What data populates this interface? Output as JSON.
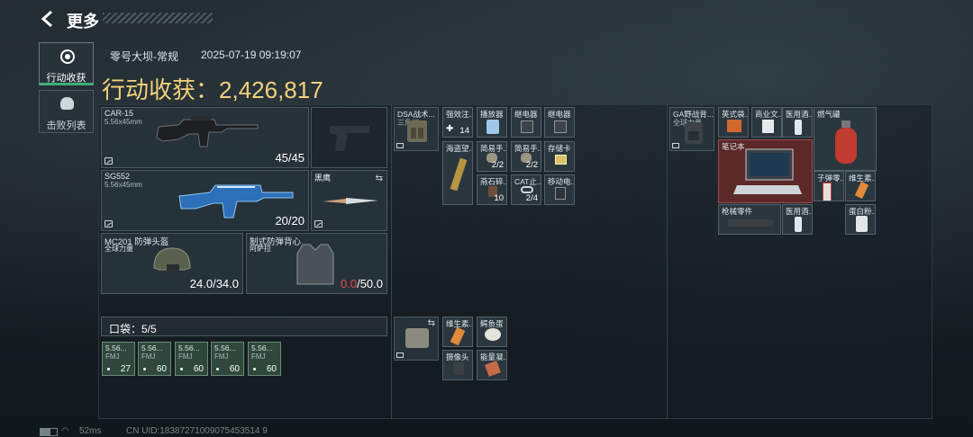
{
  "header": {
    "title": "更多"
  },
  "sidebar": {
    "items": [
      {
        "label": "行动收获"
      },
      {
        "label": "击败列表"
      }
    ]
  },
  "match": {
    "map": "零号大坝-常规",
    "datetime": "2025-07-19 09:19:07",
    "value_label": "行动收获：",
    "value": "2,426,817"
  },
  "loadout": {
    "primary": {
      "name": "CAR-15",
      "ammo": "5.56x45mm",
      "count": "45/45"
    },
    "secondary": {
      "name": "SG552",
      "ammo": "5.56x45mm",
      "count": "20/20"
    },
    "melee": {
      "name": "黑鹰"
    },
    "helmet": {
      "name": "MC201 防弹头盔",
      "brand": "全球力量",
      "dur": "24.0/34.0"
    },
    "armor": {
      "name": "制式防弹背心",
      "brand": "阿萨拉",
      "dur_current": "0.0",
      "dur_max": "/50.0"
    },
    "pockets": {
      "label": "口袋：5/5",
      "items": [
        {
          "name": "5.56...",
          "sub": "FMJ",
          "count": "27"
        },
        {
          "name": "5.56...",
          "sub": "FMJ",
          "count": "60"
        },
        {
          "name": "5.56...",
          "sub": "FMJ",
          "count": "60"
        },
        {
          "name": "5.56...",
          "sub": "FMJ",
          "count": "60"
        },
        {
          "name": "5.56...",
          "sub": "FMJ",
          "count": "60"
        }
      ]
    }
  },
  "rig": {
    "name": "DSA战术...",
    "sub": "三角洲",
    "items": [
      {
        "name": "强效注...",
        "count": "14"
      },
      {
        "name": "播放器",
        "count": ""
      },
      {
        "name": "继电器",
        "count": ""
      },
      {
        "name": "继电器",
        "count": ""
      },
      {
        "name": "海盗望...",
        "count": ""
      },
      {
        "name": "简易手...",
        "count": "2/2"
      },
      {
        "name": "简易手...",
        "count": "2/2"
      },
      {
        "name": "存储卡",
        "count": ""
      },
      {
        "name": "",
        "count": ""
      },
      {
        "name": "燕石碎...",
        "count": "10"
      },
      {
        "name": "CAT止...",
        "count": "2/4"
      },
      {
        "name": "移动电...",
        "count": ""
      }
    ]
  },
  "pouch": {
    "items": [
      {
        "name": "维生素...",
        "count": ""
      },
      {
        "name": "鳄鱼蛋",
        "count": ""
      },
      {
        "name": "摄像头",
        "count": ""
      },
      {
        "name": "能量凝...",
        "count": ""
      }
    ]
  },
  "backpack": {
    "name": "GA野战背...",
    "sub": "全球力量",
    "items": [
      {
        "name": "英式袋..."
      },
      {
        "name": "商业文..."
      },
      {
        "name": "医用酒..."
      },
      {
        "name": "燃气罐"
      },
      {
        "name": "笔记本"
      },
      {
        "name": "子弹零..."
      },
      {
        "name": "维生素..."
      },
      {
        "name": "枪械零件"
      },
      {
        "name": "医用酒..."
      },
      {
        "name": "蛋白粉..."
      }
    ]
  },
  "status": {
    "ping": "52ms",
    "uid": "CN UID:18387271009075453514 9"
  },
  "colors": {
    "accent": "#f2d27a",
    "danger": "#e24a4a",
    "nav_active": "#3fae7a"
  }
}
